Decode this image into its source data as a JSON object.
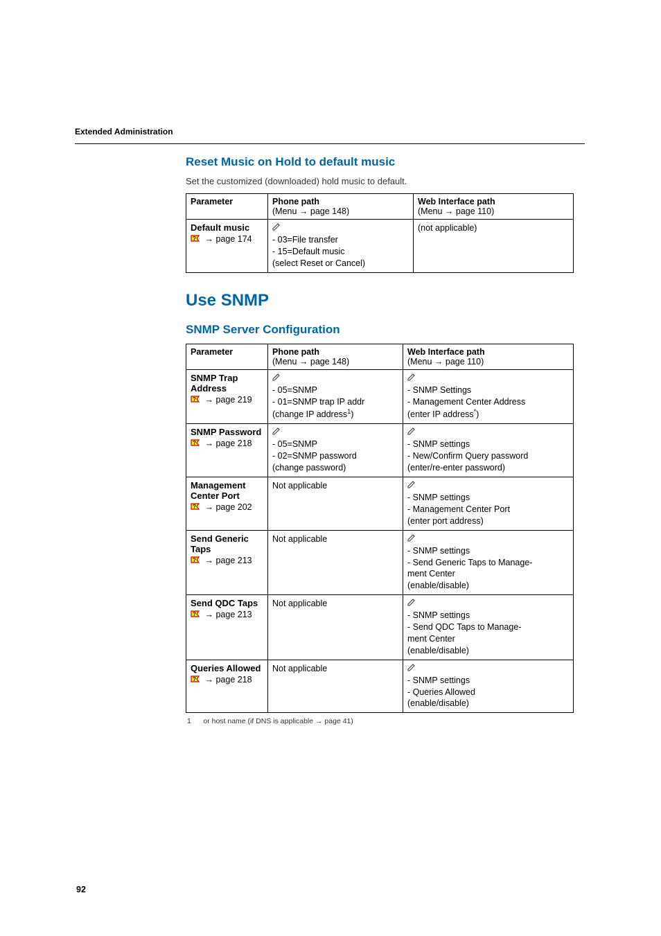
{
  "running_head": "Extended Administration",
  "page_number": "92",
  "section1": {
    "title": "Reset Music on Hold to default music",
    "intro": "Set the customized (downloaded) hold music to default.",
    "table": {
      "headers": {
        "param": "Parameter",
        "phone": "Phone path",
        "phone_menu": "(Menu → page 148)",
        "web": "Web Interface path",
        "web_menu": "(Menu → page 110)"
      },
      "row": {
        "name": "Default music",
        "page_ref": "→ page 174",
        "phone_l1": "- 03=File transfer",
        "phone_l2": "- 15=Default music",
        "phone_l3": "(select Reset or Cancel)",
        "web_l1": "(not applicable)"
      }
    }
  },
  "section2": {
    "title": "Use SNMP",
    "subtitle": "SNMP Server Configuration",
    "table": {
      "headers": {
        "param": "Parameter",
        "phone": "Phone path",
        "phone_menu": "(Menu → page 148)",
        "web": "Web Interface path",
        "web_menu": "(Menu → page 110)"
      },
      "rows": [
        {
          "name_l1": "SNMP Trap",
          "name_l2": "Address",
          "page_ref": "→ page 219",
          "phone": [
            "- 05=SNMP",
            "- 01=SNMP trap IP addr",
            "(change IP address¹)"
          ],
          "web": [
            "- SNMP Settings",
            "- Management Center Address",
            "(enter IP address*)"
          ]
        },
        {
          "name_l1": "SNMP Password",
          "name_l2": "",
          "page_ref": "→ page 218",
          "phone": [
            "- 05=SNMP",
            "- 02=SNMP password",
            "(change password)"
          ],
          "web": [
            "- SNMP settings",
            "- New/Confirm Query password",
            "(enter/re-enter password)"
          ]
        },
        {
          "name_l1": "Management",
          "name_l2": "Center Port",
          "page_ref": "→ page 202",
          "phone": [
            "Not applicable"
          ],
          "phone_no_pencil": true,
          "web": [
            "- SNMP settings",
            "- Management Center Port",
            "(enter port address)"
          ]
        },
        {
          "name_l1": "Send Generic",
          "name_l2": "Taps",
          "page_ref": "→ page 213",
          "phone": [
            "Not applicable"
          ],
          "phone_no_pencil": true,
          "web": [
            "- SNMP settings",
            "- Send Generic Taps to Manage-",
            "ment Center",
            "(enable/disable)"
          ]
        },
        {
          "name_l1": "Send QDC Taps",
          "name_l2": "",
          "page_ref": "→ page 213",
          "phone": [
            "Not applicable"
          ],
          "phone_no_pencil": true,
          "web": [
            "- SNMP settings",
            "- Send QDC Taps to Manage-",
            "ment Center",
            "(enable/disable)"
          ]
        },
        {
          "name_l1": "Queries Allowed",
          "name_l2": "",
          "page_ref": "→ page 218",
          "phone": [
            "Not applicable"
          ],
          "phone_no_pencil": true,
          "web": [
            "- SNMP settings",
            "- Queries Allowed",
            "(enable/disable)"
          ]
        }
      ]
    },
    "footnote": "or host name (if DNS is applicable → page 41)",
    "footnote_num": "1"
  }
}
